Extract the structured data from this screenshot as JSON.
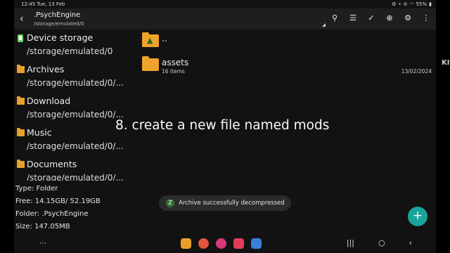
{
  "status_bar": {
    "time": "12:45 Tue, 13 Feb",
    "battery": "55%",
    "icons": [
      "settings-icon",
      "dot-icon",
      "mute-icon",
      "wifi-icon",
      "battery-icon"
    ]
  },
  "header": {
    "title": ".PsychEngine",
    "path": "/storage/emulated/0",
    "actions": [
      "search-icon",
      "list-view-icon",
      "multi-select-icon",
      "add-circle-icon",
      "gear-icon",
      "overflow-menu-icon"
    ]
  },
  "sidebar": {
    "items": [
      {
        "name": "Device storage",
        "path": "/storage/emulated/0"
      },
      {
        "name": "Archives",
        "path": "/storage/emulated/0/..."
      },
      {
        "name": "Download",
        "path": "/storage/emulated/0/..."
      },
      {
        "name": "Music",
        "path": "/storage/emulated/0/..."
      },
      {
        "name": "Documents",
        "path": "/storage/emulated/0/..."
      }
    ]
  },
  "files": [
    {
      "name": "..",
      "type": "parent",
      "sub": "",
      "date": ""
    },
    {
      "name": "assets",
      "type": "folder",
      "sub": "16 items",
      "date": "13/02/2024"
    }
  ],
  "overlay_text": "8. create a new file named mods",
  "info": {
    "type": "Type: Folder",
    "free": "Free: 14.15GB/ 52.19GB",
    "folder": "Folder: .PsychEngine",
    "size": "Size: 147.05MB"
  },
  "toast": {
    "text": "Archive successfully decompressed"
  },
  "fab_label": "+",
  "edge_text": "KI",
  "colors": {
    "accent": "#1aa39a",
    "folder": "#f0a32a",
    "background": "#121212"
  }
}
